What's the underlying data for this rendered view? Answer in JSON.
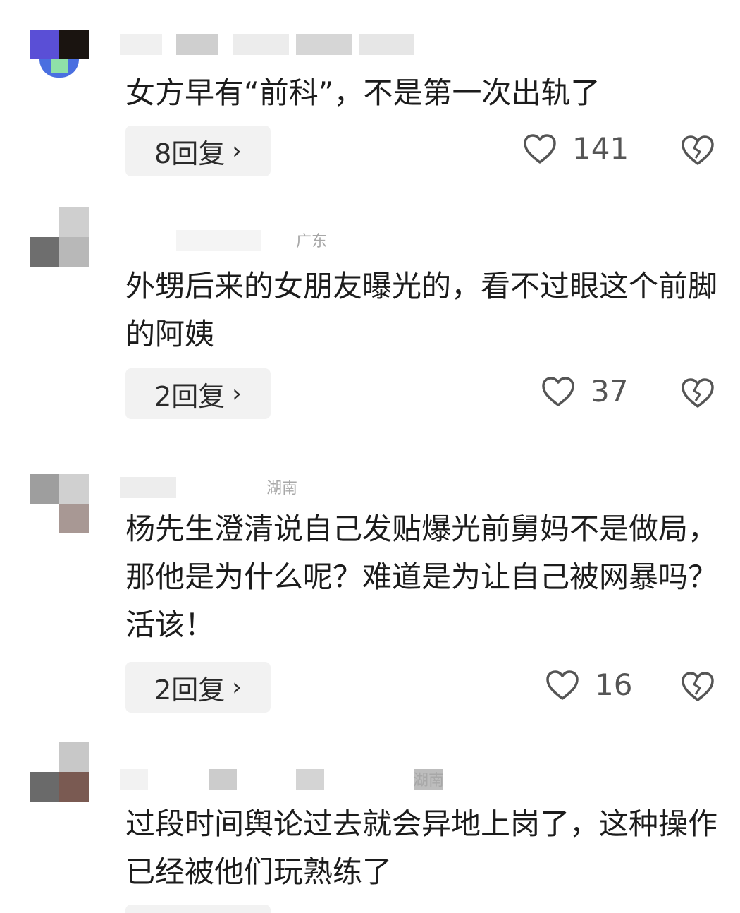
{
  "comments": [
    {
      "user_location": "",
      "text": "女方早有“前科”，不是第一次出轨了",
      "reply_count": "8回复",
      "likes": "141"
    },
    {
      "user_location": "广东",
      "text": "外甥后来的女朋友曝光的，看不过眼这个前脚的阿姨",
      "reply_count": "2回复",
      "likes": "37"
    },
    {
      "user_location": "湖南",
      "text": "杨先生澄清说自己发贴爆光前舅妈不是做局，那他是为什么呢？难道是为让自己被网暴吗？活该！",
      "reply_count": "2回复",
      "likes": "16"
    },
    {
      "user_location": "湖南",
      "text": "过段时间舆论过去就会异地上岗了，这种操作已经被他们玩熟练了",
      "reply_count": "",
      "likes": ""
    }
  ],
  "icons": {
    "like": "heart-outline-icon",
    "dislike": "broken-heart-icon",
    "reply_arrow": "chevron-right-icon"
  },
  "colors": {
    "text": "#1c1c1c",
    "meta": "#555555",
    "reply_bg": "#f2f2f2"
  }
}
